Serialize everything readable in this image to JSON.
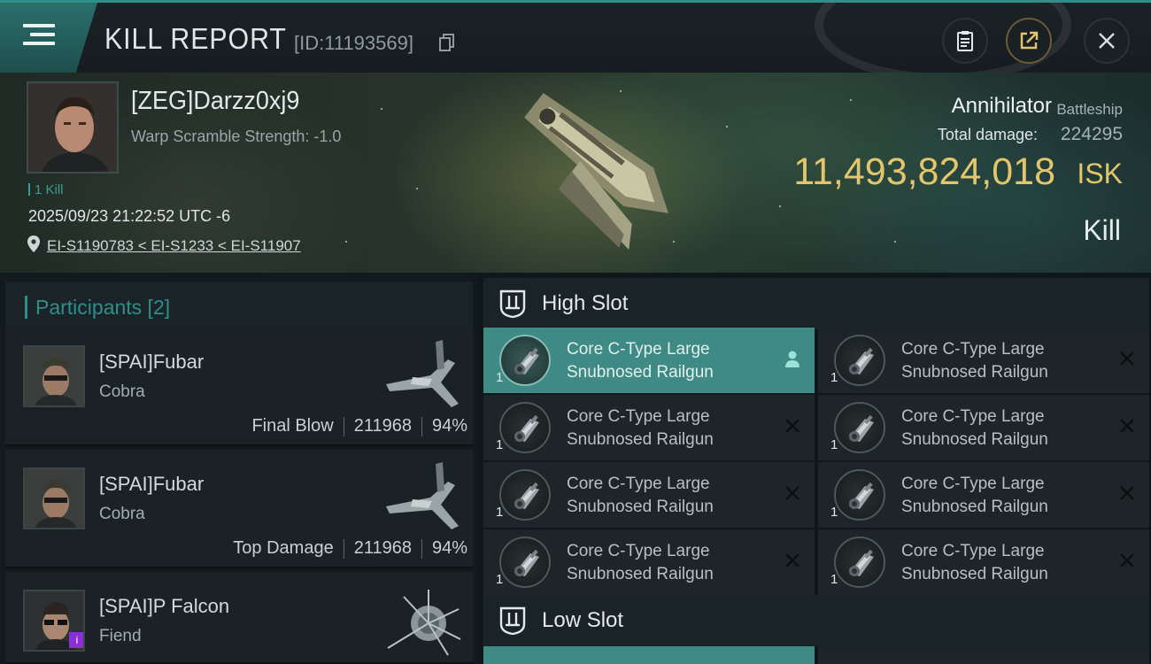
{
  "header": {
    "title": "KILL REPORT",
    "report_id": "[ID:11193569]",
    "buttons": {
      "clipboard": "clipboard-icon",
      "share": "share-icon",
      "close": "close-icon"
    }
  },
  "victim": {
    "name": "[ZEG]Darzz0xj9",
    "warp_scramble": "Warp Scramble Strength: -1.0",
    "kill_count_label": "1 Kill",
    "datetime": "2025/09/23 21:22:52 UTC -6",
    "location": "EI-S1190783 < EI-S1233 < EI-S11907",
    "ship_name": "Annihilator",
    "ship_class": "Battleship",
    "total_damage_label": "Total damage:",
    "total_damage": "224295",
    "isk_value": "11,493,824,018",
    "isk_unit": "ISK",
    "result": "Kill"
  },
  "participants": {
    "header": "Participants [2]",
    "rows": [
      {
        "name": "[SPAI]Fubar",
        "ship": "Cobra",
        "role": "Final Blow",
        "damage": "211968",
        "percent": "94%"
      },
      {
        "name": "[SPAI]Fubar",
        "ship": "Cobra",
        "role": "Top Damage",
        "damage": "211968",
        "percent": "94%"
      },
      {
        "name": "[SPAI]P Falcon",
        "ship": "Fiend",
        "badge": "i"
      }
    ]
  },
  "slots": {
    "high": {
      "label": "High Slot",
      "modules": [
        {
          "line1": "Core C-Type Large",
          "line2": "Snubnosed Railgun",
          "qty": "1",
          "status": "pilot"
        },
        {
          "line1": "Core C-Type Large",
          "line2": "Snubnosed Railgun",
          "qty": "1",
          "status": "destroyed"
        },
        {
          "line1": "Core C-Type Large",
          "line2": "Snubnosed Railgun",
          "qty": "1",
          "status": "destroyed"
        },
        {
          "line1": "Core C-Type Large",
          "line2": "Snubnosed Railgun",
          "qty": "1",
          "status": "destroyed"
        },
        {
          "line1": "Core C-Type Large",
          "line2": "Snubnosed Railgun",
          "qty": "1",
          "status": "destroyed"
        },
        {
          "line1": "Core C-Type Large",
          "line2": "Snubnosed Railgun",
          "qty": "1",
          "status": "destroyed"
        },
        {
          "line1": "Core C-Type Large",
          "line2": "Snubnosed Railgun",
          "qty": "1",
          "status": "destroyed"
        },
        {
          "line1": "Core C-Type Large",
          "line2": "Snubnosed Railgun",
          "qty": "1",
          "status": "destroyed"
        }
      ]
    },
    "low": {
      "label": "Low Slot"
    }
  },
  "colors": {
    "accent": "#2f8e88",
    "isk": "#e3c66b",
    "active_module": "#3f8a84"
  }
}
